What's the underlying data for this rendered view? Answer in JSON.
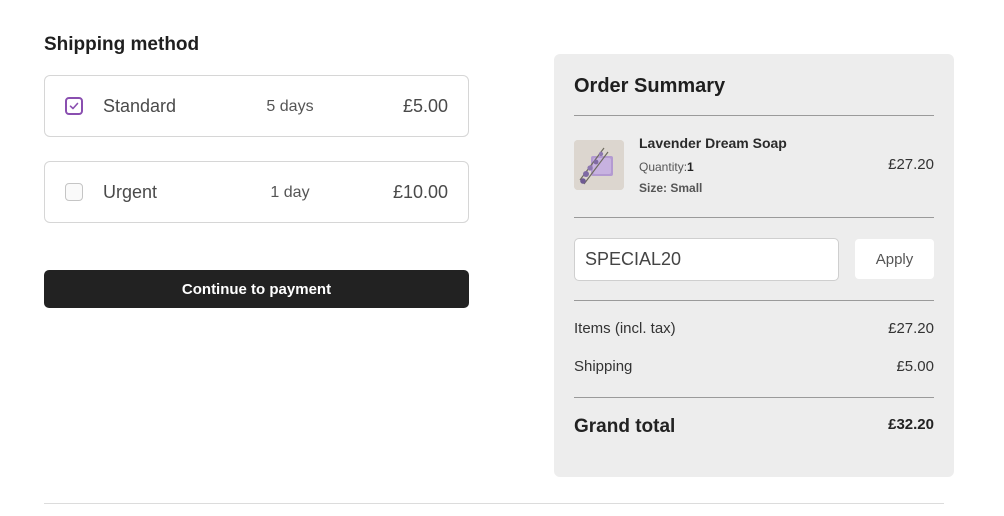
{
  "shipping": {
    "title": "Shipping method",
    "options": [
      {
        "name": "Standard",
        "duration": "5 days",
        "price": "£5.00",
        "checked": true
      },
      {
        "name": "Urgent",
        "duration": "1 day",
        "price": "£10.00",
        "checked": false
      }
    ],
    "continue_label": "Continue to payment"
  },
  "summary": {
    "title": "Order Summary",
    "product": {
      "name": "Lavender Dream Soap",
      "quantity_label": "Quantity:",
      "quantity_value": "1",
      "size": "Size: Small",
      "price": "£27.20"
    },
    "coupon": {
      "value": "SPECIAL20",
      "apply_label": "Apply"
    },
    "items_label": "Items (incl. tax)",
    "items_value": "£27.20",
    "shipping_label": "Shipping",
    "shipping_value": "£5.00",
    "grand_label": "Grand total",
    "grand_value": "£32.20"
  },
  "colors": {
    "accent": "#8a4fb0",
    "button_dark": "#222222",
    "panel_bg": "#ededed"
  },
  "icons": {
    "checked": "checkmark-icon"
  }
}
